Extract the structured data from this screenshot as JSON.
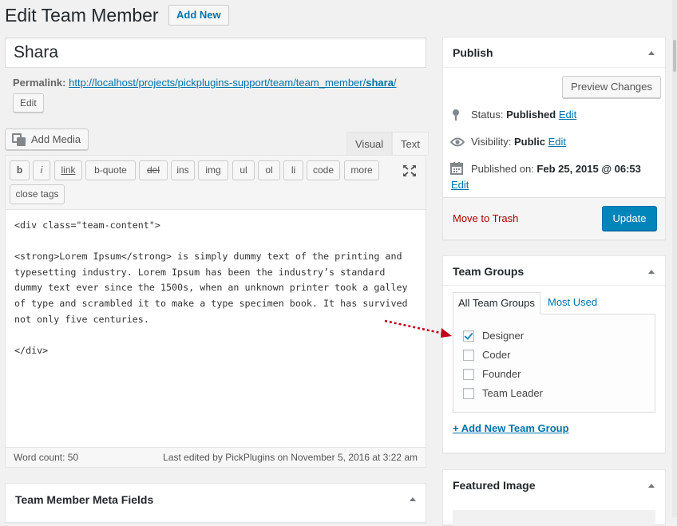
{
  "header": {
    "title": "Edit Team Member",
    "add_new_label": "Add New"
  },
  "post": {
    "title_value": "Shara",
    "permalink_label": "Permalink:",
    "permalink_base": "http://localhost/projects/pickplugins-support/team/team_member/",
    "permalink_slug": "shara",
    "permalink_trailing": "/",
    "edit_permalink_label": "Edit"
  },
  "editor": {
    "add_media_label": "Add Media",
    "tab_visual": "Visual",
    "tab_text": "Text",
    "quicktags": [
      "b",
      "i",
      "link",
      "b-quote",
      "del",
      "ins",
      "img",
      "ul",
      "ol",
      "li",
      "code",
      "more",
      "close tags"
    ],
    "content": "<div class=\"team-content\">\n\n<strong>Lorem Ipsum</strong> is simply dummy text of the printing and typesetting industry. Lorem Ipsum has been the industry’s standard dummy text ever since the 1500s, when an unknown printer took a galley of type and scrambled it to make a type specimen book. It has survived not only five centuries.\n\n</div>",
    "word_count": "Word count: 50",
    "last_edited": "Last edited by PickPlugins on November 5, 2016 at 3:22 am"
  },
  "meta_box": {
    "title": "Team Member Meta Fields"
  },
  "publish": {
    "title": "Publish",
    "preview_label": "Preview Changes",
    "status_label": "Status:",
    "status_value": "Published",
    "visibility_label": "Visibility:",
    "visibility_value": "Public",
    "published_on_label": "Published on:",
    "published_on_value": "Feb 25, 2015 @ 06:53",
    "edit_label": "Edit",
    "trash_label": "Move to Trash",
    "update_label": "Update"
  },
  "team_groups": {
    "title": "Team Groups",
    "tab_all": "All Team Groups",
    "tab_most_used": "Most Used",
    "items": [
      {
        "label": "Designer",
        "checked": true
      },
      {
        "label": "Coder",
        "checked": false
      },
      {
        "label": "Founder",
        "checked": false
      },
      {
        "label": "Team Leader",
        "checked": false
      }
    ],
    "add_new_label": "+ Add New Team Group"
  },
  "featured_image": {
    "title": "Featured Image"
  },
  "colors": {
    "primary": "#0085ba",
    "link": "#0073aa",
    "trash": "#aa0000",
    "annotation_arrow": "#c0001a"
  }
}
